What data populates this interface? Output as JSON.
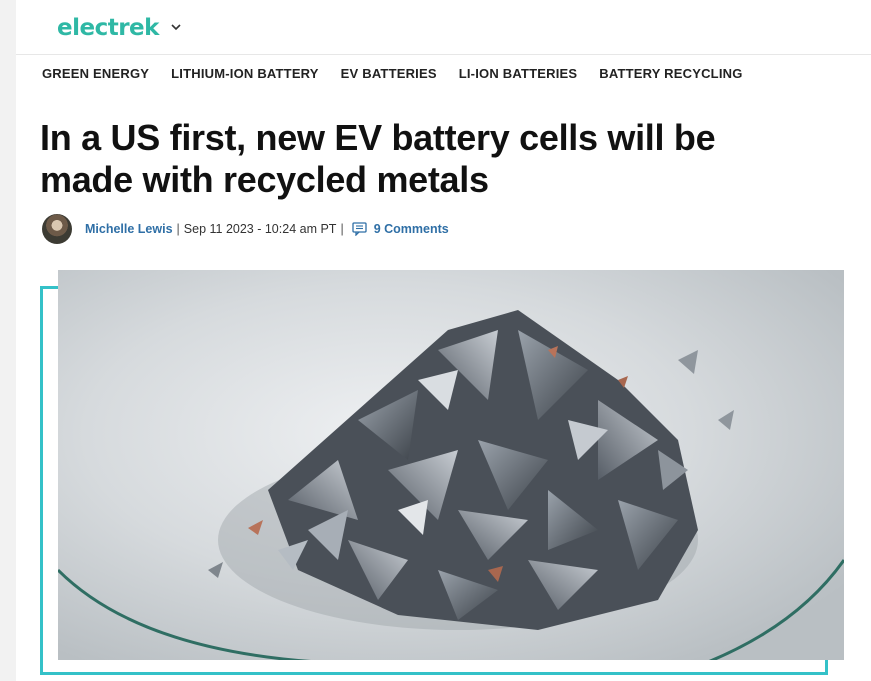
{
  "site": {
    "logo_text": "electrek",
    "accent_color": "#2fb8a5"
  },
  "tags": [
    "GREEN ENERGY",
    "LITHIUM-ION BATTERY",
    "EV BATTERIES",
    "LI-ION BATTERIES",
    "BATTERY RECYCLING"
  ],
  "article": {
    "title": "In a US first, new EV battery cells will be made with recycled metals",
    "author": "Michelle Lewis",
    "separator": "|",
    "date": "Sep 11 2023 - 10:24 am PT",
    "comments_label": "9 Comments",
    "frame_color": "#34c1c8"
  },
  "icons": {
    "logo_menu": "chevron-down-icon",
    "comments": "comment-icon"
  }
}
